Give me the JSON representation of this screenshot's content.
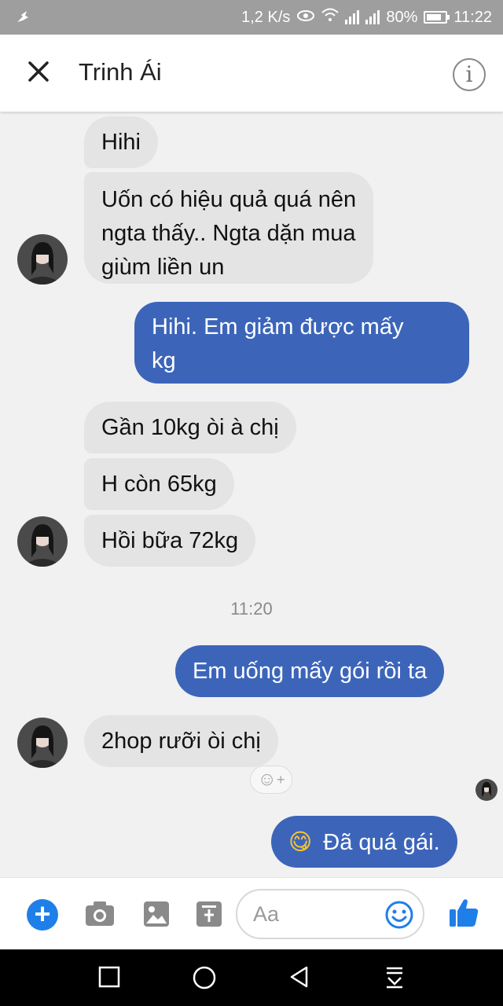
{
  "status": {
    "speed": "1,2 K/s",
    "battery": "80%",
    "time": "11:22"
  },
  "header": {
    "title": "Trinh Ái",
    "info_glyph": "i"
  },
  "messages": {
    "m1": "Hihi",
    "m2_line1": "Uốn có hiệu quả quá nên",
    "m2_line2": "ngta thấy.. Ngta dặn mua",
    "m2_line3": "giùm liền un",
    "m3_line1": "Hihi. Em giảm được mấy",
    "m3_line2": "kg",
    "m4": "Gần 10kg òi à chị",
    "m5": "H còn 65kg",
    "m6": "Hồi bữa 72kg",
    "timestamp": "11:20",
    "m7": "Em uống mấy gói rồi ta",
    "m8": "2hop rưỡi òi chị",
    "m9_emoji": "😋",
    "m9": "Đã quá gái."
  },
  "composer": {
    "placeholder": "Aa",
    "react_plus": "+"
  },
  "colors": {
    "outgoing_bubble": "#3c65ba",
    "incoming_bubble": "#e4e4e4",
    "accent": "#1e7fe8"
  },
  "icons": [
    "close-icon",
    "info-icon",
    "plus-icon",
    "camera-icon",
    "gallery-icon",
    "sticker-icon",
    "emoji-icon",
    "thumbs-up-icon",
    "nav-recent-icon",
    "nav-home-icon",
    "nav-back-icon",
    "nav-notify-icon"
  ]
}
